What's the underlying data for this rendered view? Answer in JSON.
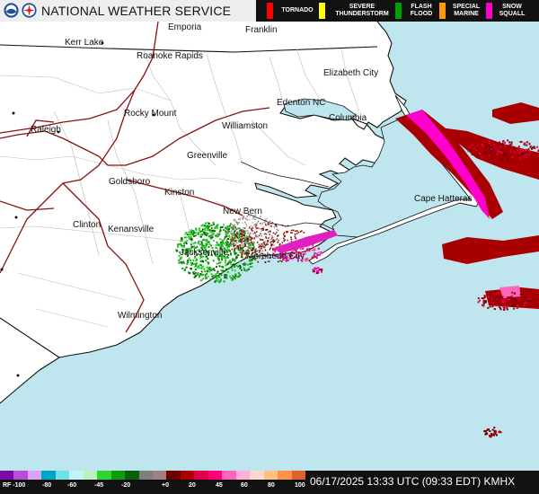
{
  "header": {
    "agency_name": "NATIONAL WEATHER SERVICE",
    "logos": [
      "noaa-logo",
      "nws-logo"
    ]
  },
  "legend": [
    {
      "key": "tornado",
      "label": "TORNADO",
      "color": "#ff0000"
    },
    {
      "key": "severe-thunderstorm",
      "label": "SEVERE THUNDERSTORM",
      "color": "#ffff00"
    },
    {
      "key": "flash-flood",
      "label": "FLASH FLOOD",
      "color": "#00a000"
    },
    {
      "key": "special-marine",
      "label": "SPECIAL MARINE",
      "color": "#ff9900"
    },
    {
      "key": "snow-squall",
      "label": "SNOW SQUALL",
      "color": "#ff00cc"
    }
  ],
  "cities": [
    "Emporia",
    "Franklin",
    "Kerr Lake",
    "Roanoke Rapids",
    "Elizabeth City",
    "Edenton NC",
    "Rocky Mount",
    "Raleigh",
    "Columbia",
    "Williamston",
    "Greenville",
    "Goldsboro",
    "Kinston",
    "Cape Hatteras",
    "New Bern",
    "Clinton",
    "Kenansville",
    "Jacksonville",
    "Morehead City",
    "Wilmington"
  ],
  "colorbar": {
    "ticks": [
      "RF -100",
      "-80",
      "-60",
      "-45",
      "-20",
      "+0",
      "20",
      "45",
      "60",
      "80",
      "100"
    ],
    "colors": [
      "#7d0aa8",
      "#b44fd6",
      "#d9a3ef",
      "#00a4c8",
      "#6fe0ea",
      "#bff5f8",
      "#bdf0bd",
      "#2fd52f",
      "#0f9a0f",
      "#0a5f0a",
      "#7f7f7f",
      "#a08080",
      "#6b0000",
      "#a80000",
      "#e0004a",
      "#ff0078",
      "#ff66bb",
      "#ffb0d9",
      "#ffd6d0",
      "#ffc082",
      "#ff9248",
      "#e06030"
    ]
  },
  "status": {
    "timestamp": "06/17/2025 13:33 UTC (09:33 EDT)",
    "station": "KMHX"
  }
}
